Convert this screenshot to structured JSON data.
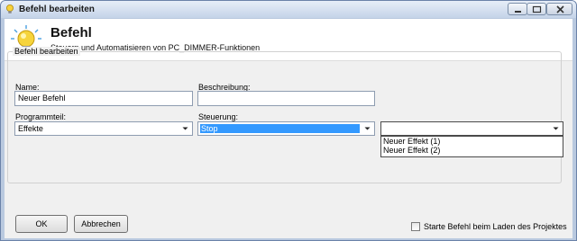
{
  "window": {
    "title": "Befehl bearbeiten",
    "icon": "lightbulb-icon"
  },
  "header": {
    "title": "Befehl",
    "subtitle": "Steuern und Automatisieren von PC_DIMMER-Funktionen",
    "icon": "lightbulb-icon"
  },
  "group": {
    "label": "Befehl bearbeiten"
  },
  "form": {
    "name_label": "Name:",
    "name_value": "Neuer Befehl",
    "description_label": "Beschreibung:",
    "description_value": "",
    "programmteil_label": "Programmteil:",
    "programmteil_value": "Effekte",
    "steuerung_label": "Steuerung:",
    "steuerung_value": "Stop",
    "effect_value": ""
  },
  "effect_dropdown": {
    "options": [
      "Neuer Effekt (1)",
      "Neuer Effekt (2)"
    ]
  },
  "footer": {
    "ok_label": "OK",
    "cancel_label": "Abbrechen",
    "checkbox_label": "Starte Befehl beim Laden des Projektes",
    "checkbox_checked": false
  }
}
